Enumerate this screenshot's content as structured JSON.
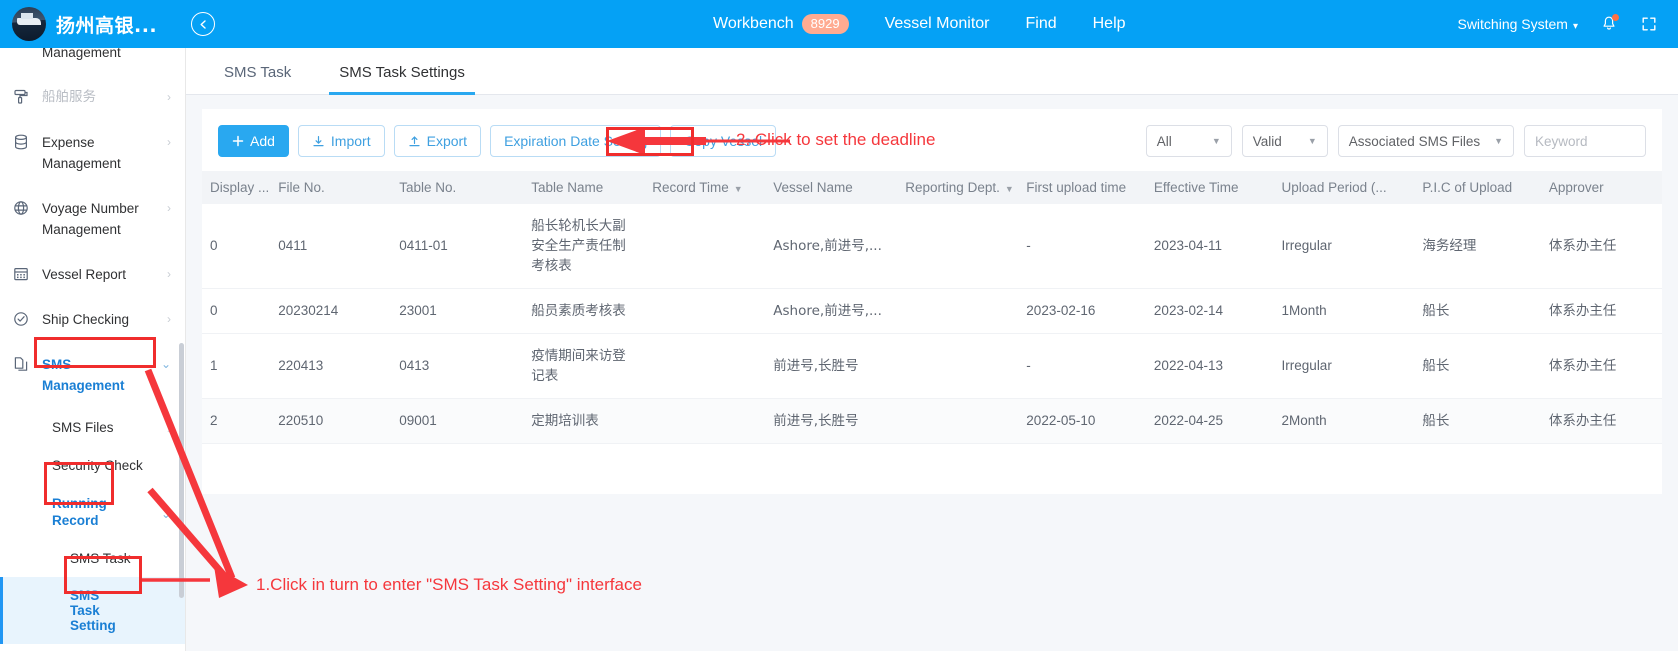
{
  "header": {
    "brand_title": "扬州高银...",
    "logo_icon": "ship-logo",
    "collapse_icon": "collapse-left-icon",
    "nav": [
      {
        "label": "Workbench",
        "badge": "8929"
      },
      {
        "label": "Vessel Monitor",
        "badge": ""
      },
      {
        "label": "Find",
        "badge": ""
      },
      {
        "label": "Help",
        "badge": ""
      }
    ],
    "switching_system": "Switching System",
    "bell_icon": "bell-icon",
    "fullscreen_icon": "fullscreen-expand-icon",
    "bg_color": "#05a1f5"
  },
  "sidebar": {
    "top_cutoff_label": "Management",
    "items": [
      {
        "label": "船舶服务",
        "icon": "roller-icon",
        "dim": true,
        "arrow": "›"
      },
      {
        "label": "Expense Management",
        "icon": "database-icon",
        "dim": false,
        "arrow": "›"
      },
      {
        "label": "Voyage Number Management",
        "icon": "globe-icon",
        "dim": false,
        "arrow": "›"
      },
      {
        "label": "Vessel Report",
        "icon": "calendar-icon",
        "dim": false,
        "arrow": "›"
      },
      {
        "label": "Ship Checking",
        "icon": "check-circle-icon",
        "dim": false,
        "arrow": "›"
      },
      {
        "label": "SMS Management",
        "icon": "documents-icon",
        "dim": false,
        "arrow": "⌄",
        "highlighted": true
      }
    ],
    "sub_items": [
      {
        "label": "SMS Files",
        "arrow": "›",
        "active": false,
        "highlighted": false
      },
      {
        "label": "Security Check",
        "arrow": "",
        "active": false,
        "highlighted": false
      },
      {
        "label": "Running Record",
        "arrow": "⌄",
        "active": false,
        "highlighted": true
      },
      {
        "label": "SMS Task",
        "arrow": "",
        "active": false,
        "highlighted": false
      },
      {
        "label": "SMS Task Setting",
        "arrow": "",
        "active": true,
        "highlighted": true
      }
    ]
  },
  "tabs": [
    {
      "label": "SMS Task",
      "active": false
    },
    {
      "label": "SMS Task Settings",
      "active": true
    }
  ],
  "toolbar": {
    "add_label": "Add",
    "add_icon": "plus-icon",
    "import_label": "Import",
    "import_icon": "download-icon",
    "export_label": "Export",
    "export_icon": "upload-icon",
    "expiration_label": "Expiration Date Setting",
    "copy_vessel_label": "Copy Vessel"
  },
  "filters": {
    "scope": "All",
    "status": "Valid",
    "association": "Associated SMS Files",
    "keyword_placeholder": "Keyword",
    "keyword_value": "",
    "dropdown_icon": "chevron-down-icon"
  },
  "table": {
    "columns": [
      {
        "label": "Display ...",
        "sort": false
      },
      {
        "label": "File No.",
        "sort": false
      },
      {
        "label": "Table No.",
        "sort": false
      },
      {
        "label": "Table Name",
        "sort": false
      },
      {
        "label": "Record Time",
        "sort": true
      },
      {
        "label": "Vessel Name",
        "sort": false
      },
      {
        "label": "Reporting Dept.",
        "sort": true
      },
      {
        "label": "First upload time",
        "sort": false
      },
      {
        "label": "Effective Time",
        "sort": false
      },
      {
        "label": "Upload Period (...",
        "sort": false
      },
      {
        "label": "P.I.C of Upload",
        "sort": false
      },
      {
        "label": "Approver",
        "sort": false
      }
    ],
    "rows": [
      {
        "display": "0",
        "file_no": "0411",
        "table_no": "0411-01",
        "table_name": "船长轮机长大副安全生产责任制考核表",
        "record_time": "",
        "vessel_name": "Ashore,前进号,...",
        "reporting_dept": "",
        "first_upload_time": "-",
        "effective_time": "2023-04-11",
        "upload_period": "Irregular",
        "pic_of_upload": "海务经理",
        "approver": "体系办主任"
      },
      {
        "display": "0",
        "file_no": "20230214",
        "table_no": "23001",
        "table_name": "船员素质考核表",
        "record_time": "",
        "vessel_name": "Ashore,前进号,...",
        "reporting_dept": "",
        "first_upload_time": "2023-02-16",
        "effective_time": "2023-02-14",
        "upload_period": "1Month",
        "pic_of_upload": "船长",
        "approver": "体系办主任"
      },
      {
        "display": "1",
        "file_no": "220413",
        "table_no": "0413",
        "table_name": "疫情期间来访登记表",
        "record_time": "",
        "vessel_name": "前进号,长胜号",
        "reporting_dept": "",
        "first_upload_time": "-",
        "effective_time": "2022-04-13",
        "upload_period": "Irregular",
        "pic_of_upload": "船长",
        "approver": "体系办主任"
      },
      {
        "display": "2",
        "file_no": "220510",
        "table_no": "09001",
        "table_name": "定期培训表",
        "record_time": "",
        "vessel_name": "前进号,长胜号",
        "reporting_dept": "",
        "first_upload_time": "2022-05-10",
        "effective_time": "2022-04-25",
        "upload_period": "2Month",
        "pic_of_upload": "船长",
        "approver": "体系办主任"
      }
    ]
  },
  "annotations": {
    "step1": "1.Click in turn to enter \"SMS Task Setting\" interface",
    "step2": "2. Click to set the deadline",
    "color": "#f5373c"
  }
}
